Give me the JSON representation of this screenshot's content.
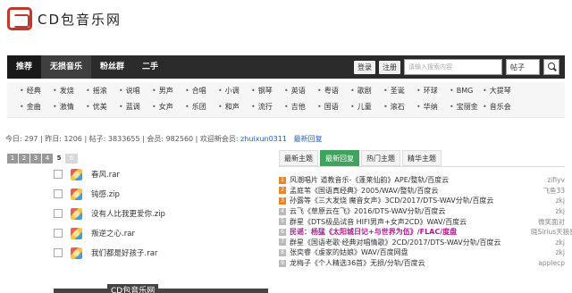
{
  "site": {
    "logo_text": "CD包音乐网"
  },
  "nav": {
    "items": [
      "推荐",
      "无损音乐",
      "粉丝群",
      "二手"
    ],
    "login": "登录",
    "register": "注册",
    "search_placeholder": "请输入搜索内容",
    "search_scope": "帖子"
  },
  "categories": {
    "row1": [
      "经典",
      "发烧",
      "摇滚",
      "说唱",
      "男声",
      "合唱",
      "小调",
      "钢琴",
      "英语",
      "粤语",
      "歌剧",
      "圣诞",
      "环球",
      "BMG",
      "大提琴"
    ],
    "row2": [
      "金曲",
      "激情",
      "优美",
      "蓝调",
      "女声",
      "乐团",
      "和声",
      "流行",
      "吉他",
      "国语",
      "儿童",
      "滚石",
      "华纳",
      "宝丽金",
      "音乐会"
    ]
  },
  "stats": {
    "today": "今日: 297",
    "yesterday": "昨日: 1206",
    "posts": "帖子: 3833655",
    "members": "会员: 982560",
    "welcome": "欢迎新会员:",
    "new_member": "zhuixun0311",
    "latest": "最新回复"
  },
  "pager": [
    "1",
    "2",
    "3",
    "4",
    "5",
    "6"
  ],
  "albums": [
    "春风.rar",
    "钝感.zip",
    "没有人比我更爱你.zip",
    "叛逆之心.rar",
    "我们都是好孩子.rar"
  ],
  "bottom_logo": "CD包音乐网",
  "right_tabs": [
    "最新主题",
    "最新回复",
    "热门主题",
    "精华主题"
  ],
  "hot": [
    {
      "num": "1",
      "title": "风潮唱片 道教音乐-《蓬莱仙韵》APE/整轨/百度云",
      "user": "zifiyv"
    },
    {
      "num": "2",
      "title": "孟庭苇《国语真经典》2005/WAV/整轨/百度云",
      "user": "飞鱼33"
    },
    {
      "num": "3",
      "title": "孙露等《三大发烧 魔音女声》3CD/2017/DTS-WAV分轨/百度云",
      "user": "zkj"
    },
    {
      "num": "4",
      "title": "云飞《草原云在飞》2016/DTS-WAV分轨/百度云",
      "user": "zkj"
    },
    {
      "num": "5",
      "title": "群星《DTS极品试音 HIFI男声+女声2CD》WAV/百度云",
      "user": "微笑面对"
    },
    {
      "num": "6",
      "title": "民谣：杨猛《太阳城日记+与世界为伍》/FLAC/度盘",
      "user": "晓Sirius天狼星"
    },
    {
      "num": "7",
      "title": "群星《国语老歌·经典对唱情歌》2CD/2017/DTS-WAV分轨/百度云",
      "user": "zkj"
    },
    {
      "num": "8",
      "title": "张奕睿《虔家的姑娘》WAV/百度网盘",
      "user": "zkj"
    },
    {
      "num": "9",
      "title": "龙梅子《个人精选36首》无损/分轨/百度云",
      "user": "applecp"
    }
  ],
  "colors": {
    "nav_bg": "#2b2b2b",
    "accent_green": "#3da35d",
    "link_blue": "#2a62b8",
    "hot_red": "#b01a8e"
  }
}
